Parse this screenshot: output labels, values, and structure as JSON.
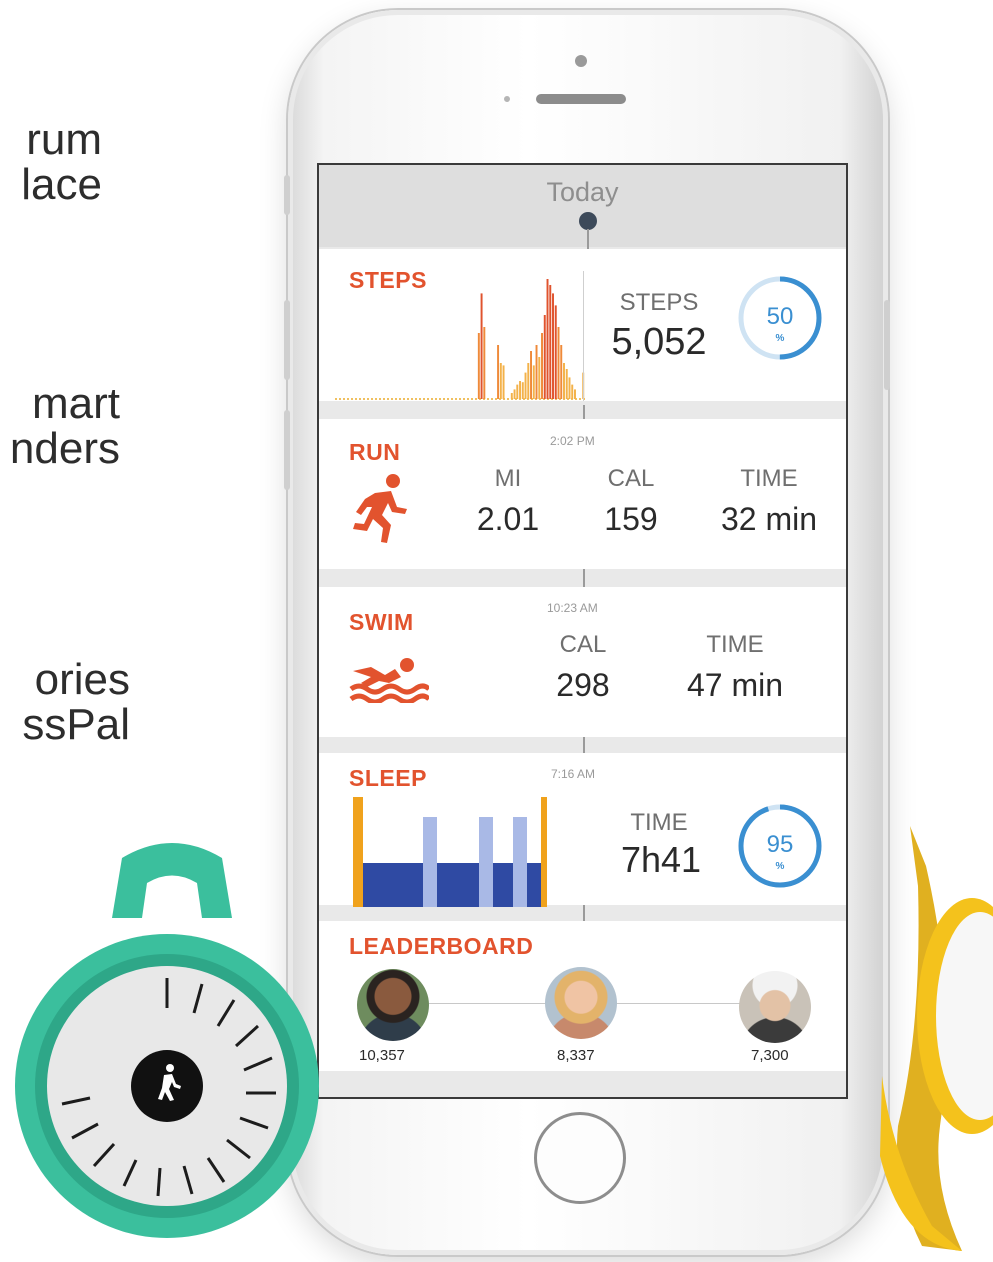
{
  "side_text": {
    "block1": [
      "rum",
      "lace"
    ],
    "block2": [
      "mart",
      "nders"
    ],
    "block3": [
      "ories",
      "ssPal"
    ]
  },
  "screen": {
    "header": "Today",
    "steps": {
      "title": "STEPS",
      "label": "STEPS",
      "value": "5,052",
      "goal_percent": "50",
      "percent_sign": "%",
      "chart_data": {
        "type": "bar",
        "title": "",
        "values": [
          0,
          0,
          0,
          0,
          0,
          0,
          0,
          0,
          0,
          0,
          0,
          0,
          0,
          0,
          0,
          0,
          0,
          0,
          0,
          0,
          0,
          0,
          0,
          0,
          0,
          0,
          0,
          0,
          0,
          0,
          0,
          0,
          0,
          0,
          0,
          0,
          0,
          0,
          0,
          0,
          0,
          0,
          0,
          0,
          0,
          0,
          0,
          0,
          0,
          0,
          0,
          0,
          55,
          88,
          60,
          0,
          0,
          0,
          0,
          45,
          30,
          28,
          0,
          0,
          5,
          8,
          12,
          15,
          14,
          22,
          30,
          40,
          28,
          45,
          35,
          55,
          70,
          100,
          95,
          88,
          78,
          60,
          45,
          30,
          25,
          18,
          12,
          8,
          0,
          0,
          22
        ]
      }
    },
    "run": {
      "title": "RUN",
      "time": "2:02 PM",
      "stats": [
        {
          "label": "MI",
          "value": "2.01"
        },
        {
          "label": "CAL",
          "value": "159"
        },
        {
          "label": "TIME",
          "value": "32 min"
        }
      ]
    },
    "swim": {
      "title": "SWIM",
      "time": "10:23 AM",
      "stats": [
        {
          "label": "CAL",
          "value": "298"
        },
        {
          "label": "TIME",
          "value": "47 min"
        }
      ]
    },
    "sleep": {
      "title": "SLEEP",
      "time": "7:16 AM",
      "label": "TIME",
      "value": "7h41",
      "goal_percent": "95",
      "percent_sign": "%"
    },
    "leaderboard": {
      "title": "LEADERBOARD",
      "entries": [
        {
          "score": "10,357"
        },
        {
          "score": "8,337"
        },
        {
          "score": "7,300"
        }
      ]
    }
  },
  "colors": {
    "accent": "#e2532e",
    "ring": "#3a8fd1",
    "sleep_deep": "#2f4aa3",
    "sleep_light": "#a9b9e6",
    "sleep_awake": "#f0a21c",
    "tracker_green": "#3bbf9d",
    "tracker_yellow": "#f4c21c"
  }
}
